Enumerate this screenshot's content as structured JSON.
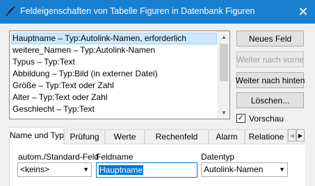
{
  "window": {
    "title": "Feldeigenschaften von Tabelle Figuren in Datenbank Figuren",
    "close_glyph": "✕"
  },
  "field_list": {
    "items": [
      {
        "label": "Hauptname – Typ:Autolink-Namen, erforderlich",
        "selected": true
      },
      {
        "label": "weitere_Namen – Typ:Autolink-Namen",
        "selected": false
      },
      {
        "label": "Typus – Typ:Text",
        "selected": false
      },
      {
        "label": "Abbildung – Typ:Bild (in externer Datei)",
        "selected": false
      },
      {
        "label": "Größe – Typ:Text oder Zahl",
        "selected": false
      },
      {
        "label": "Alter – Typ:Text oder Zahl",
        "selected": false
      },
      {
        "label": "Geschlecht – Typ:Text",
        "selected": false
      }
    ]
  },
  "buttons": {
    "new_field": "Neues Feld",
    "move_up": "Weiter nach vorne",
    "move_down": "Weiter nach hinten",
    "delete": "Löschen..."
  },
  "preview": {
    "label": "Vorschau",
    "checked": true
  },
  "tabs": [
    {
      "label": "Name und Typ",
      "active": true
    },
    {
      "label": "Prüfung",
      "active": false
    },
    {
      "label": "Werte",
      "active": false
    },
    {
      "label": "Rechenfeld",
      "active": false
    },
    {
      "label": "Alarm",
      "active": false
    },
    {
      "label": "Relatione",
      "active": false
    }
  ],
  "form": {
    "default_field_label": "autom./Standard-Feld",
    "default_field_value": "<keins>",
    "fieldname_label": "Feldname",
    "fieldname_value": "Hauptname",
    "datatype_label": "Datentyp",
    "datatype_value": "Autolink-Namen"
  },
  "colors": {
    "titlebar": "#1b7fd0",
    "selection": "#cce8ff",
    "accent": "#0078d7"
  }
}
